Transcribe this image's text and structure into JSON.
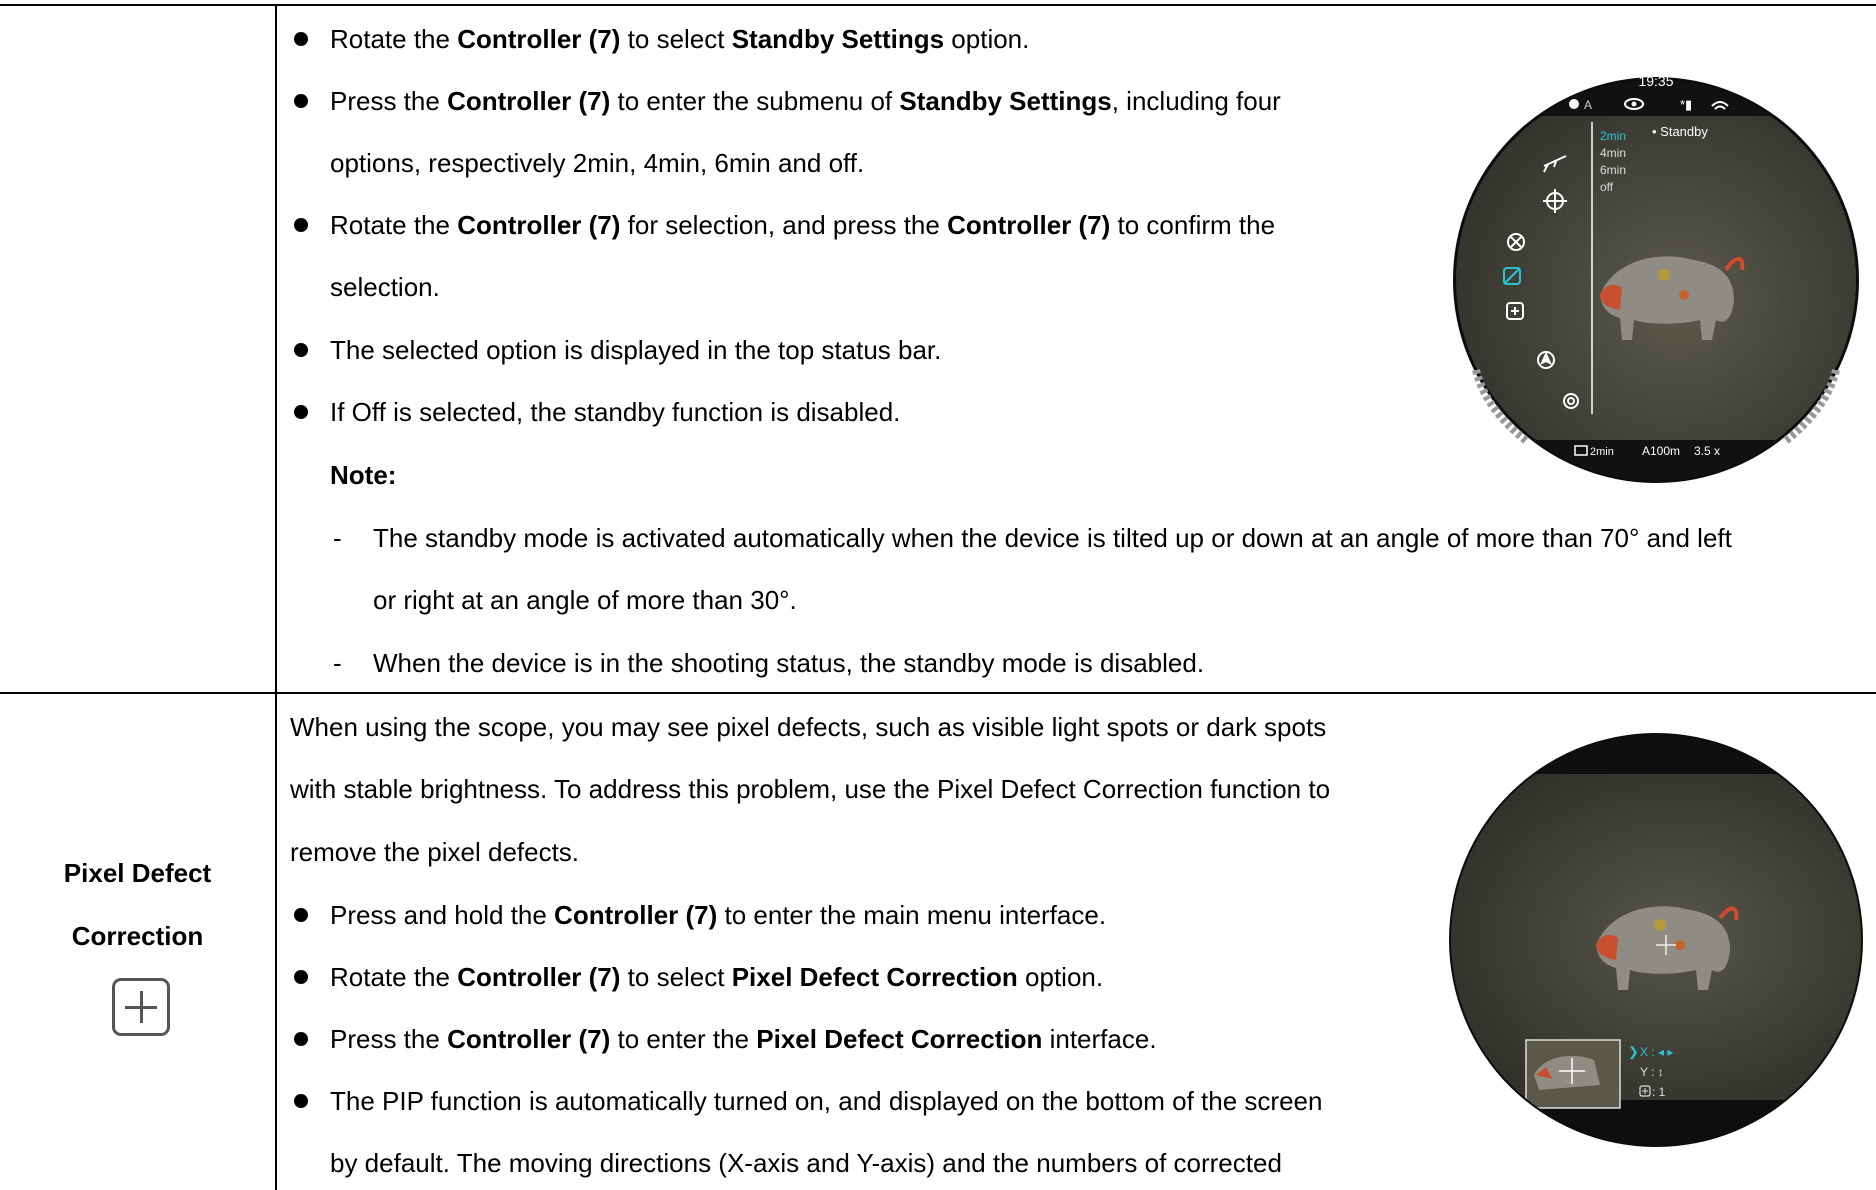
{
  "standby": {
    "b1": {
      "t1": "Rotate the ",
      "b1": "Controller (7)",
      "t2": " to select ",
      "b2": "Standby Settings",
      "t3": " option."
    },
    "b2": {
      "t1": "Press the ",
      "b1": "Controller (7)",
      "t2": " to enter the submenu of ",
      "b2": "Standby Settings",
      "t3": ", including four",
      "l2": "options, respectively 2min, 4min, 6min and off."
    },
    "b3": {
      "t1": "Rotate the ",
      "b1": "Controller (7)",
      "t2": " for selection, and press the ",
      "b2": "Controller (7)",
      "t3": " to confirm the",
      "l2": "selection."
    },
    "b4": "The selected option is displayed in the top status bar.",
    "b5": "If Off is selected, the standby function is disabled.",
    "note_label": "Note:",
    "n1_l1": "The standby mode is activated automatically when the device is tilted up or down at an angle of more than 70° and left",
    "n1_l2": "or right at an angle of more than 30°.",
    "n2": "When the device is in the shooting status, the standby mode is disabled.",
    "dash": "-"
  },
  "scope1": {
    "time": "19:35",
    "status_a": "A",
    "menu_title": "• Standby",
    "options": [
      "2min",
      "4min",
      "6min",
      "off"
    ],
    "bottom_standby": "2min",
    "bottom_range": "A100m",
    "bottom_zoom": "3.5 x",
    "accent": "#29c4d6",
    "icons": [
      "rifle-icon",
      "crosshair-icon",
      "aperture-icon",
      "standby-icon",
      "pixel-correction-icon",
      "compass-icon",
      "gear-icon"
    ]
  },
  "pixel": {
    "label_l1": "Pixel Defect",
    "label_l2": "Correction",
    "p1": "When using the scope, you may see pixel defects, such as visible light spots or dark spots",
    "p2": "with stable brightness. To address this problem, use the Pixel Defect Correction function to",
    "p3": "remove the pixel defects.",
    "b1": {
      "t1": "Press and hold the ",
      "b1": "Controller (7)",
      "t2": " to enter the main menu interface."
    },
    "b2": {
      "t1": "Rotate the ",
      "b1": "Controller (7)",
      "t2": " to select ",
      "b2": "Pixel Defect Correction",
      "t3": " option."
    },
    "b3": {
      "t1": "Press the ",
      "b1": "Controller (7)",
      "t2": " to enter the ",
      "b2": "Pixel Defect Correction",
      "t3": " interface."
    },
    "b4_l1": "The PIP function is automatically turned on, and displayed on the bottom of the screen",
    "b4_l2": "by default. The moving directions (X-axis and Y-axis) and the numbers of corrected"
  },
  "scope2": {
    "x_label": "X : ◂ ▸",
    "y_label": "Y : ↕",
    "count_label": ": 1",
    "accent": "#29c4d6"
  }
}
